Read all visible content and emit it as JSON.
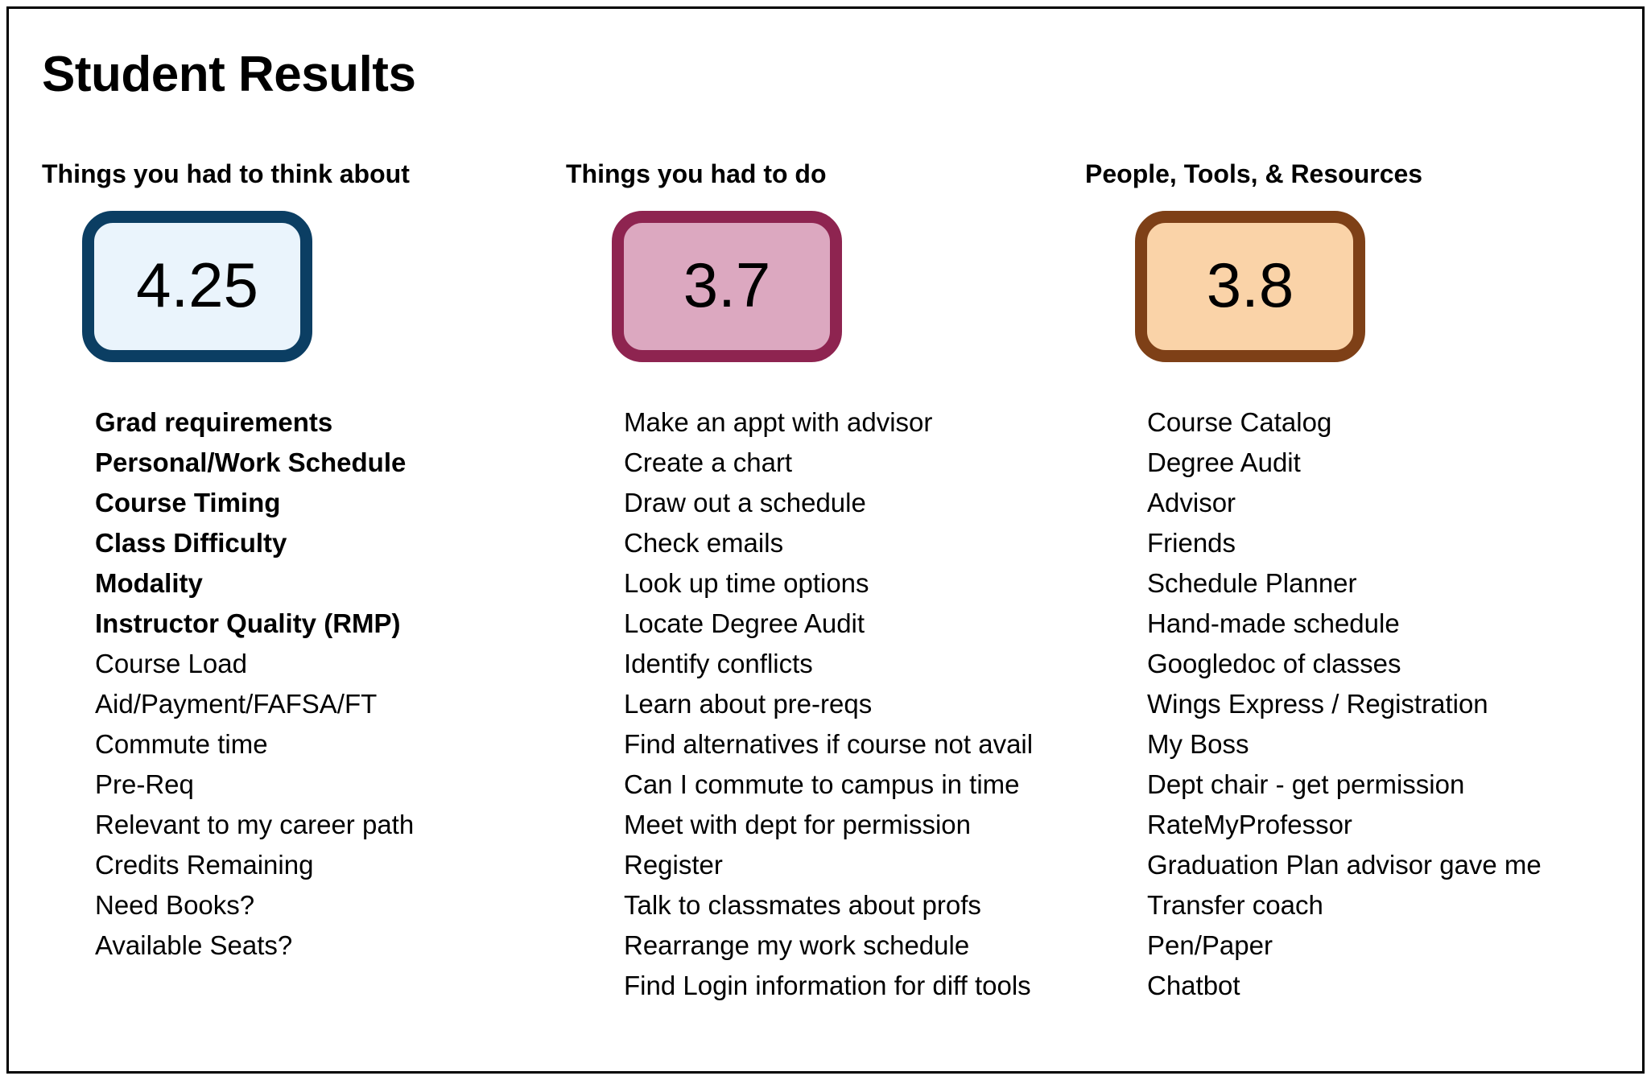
{
  "page": {
    "title": "Student Results",
    "border_color": "#000000",
    "background": "#ffffff"
  },
  "columns": [
    {
      "header": "Things you had to think about",
      "score": "4.25",
      "box_border_color": "#0B3E63",
      "box_fill_color": "#EAF4FC",
      "items": [
        {
          "label": "Grad requirements",
          "bold": true
        },
        {
          "label": "Personal/Work Schedule",
          "bold": true
        },
        {
          "label": "Course Timing",
          "bold": true
        },
        {
          "label": "Class Difficulty",
          "bold": true
        },
        {
          "label": "Modality",
          "bold": true
        },
        {
          "label": "Instructor Quality (RMP)",
          "bold": true
        },
        {
          "label": "Course Load",
          "bold": false
        },
        {
          "label": "Aid/Payment/FAFSA/FT",
          "bold": false
        },
        {
          "label": "Commute time",
          "bold": false
        },
        {
          "label": "Pre-Req",
          "bold": false
        },
        {
          "label": "Relevant to my career path",
          "bold": false
        },
        {
          "label": "Credits Remaining",
          "bold": false
        },
        {
          "label": "Need Books?",
          "bold": false
        },
        {
          "label": "Available Seats?",
          "bold": false
        }
      ]
    },
    {
      "header": "Things you had to do",
      "score": "3.7",
      "box_border_color": "#8E2450",
      "box_fill_color": "#DCA8C0",
      "items": [
        {
          "label": "Make an appt with advisor",
          "bold": false
        },
        {
          "label": "Create a chart",
          "bold": false
        },
        {
          "label": "Draw out a schedule",
          "bold": false
        },
        {
          "label": "Check emails",
          "bold": false
        },
        {
          "label": "Look up time options",
          "bold": false
        },
        {
          "label": "Locate Degree Audit",
          "bold": false
        },
        {
          "label": "Identify conflicts",
          "bold": false
        },
        {
          "label": "Learn about pre-reqs",
          "bold": false
        },
        {
          "label": "Find alternatives if course not avail",
          "bold": false
        },
        {
          "label": "Can I commute to campus in time",
          "bold": false
        },
        {
          "label": "Meet with dept for permission",
          "bold": false
        },
        {
          "label": "Register",
          "bold": false
        },
        {
          "label": "Talk to classmates about profs",
          "bold": false
        },
        {
          "label": "Rearrange my work schedule",
          "bold": false
        },
        {
          "label": "Find Login information for diff tools",
          "bold": false
        }
      ]
    },
    {
      "header": "People, Tools, & Resources",
      "score": "3.8",
      "box_border_color": "#7E4017",
      "box_fill_color": "#FAD3A8",
      "items": [
        {
          "label": "Course Catalog",
          "bold": false
        },
        {
          "label": "Degree Audit",
          "bold": false
        },
        {
          "label": "Advisor",
          "bold": false
        },
        {
          "label": "Friends",
          "bold": false
        },
        {
          "label": "Schedule Planner",
          "bold": false
        },
        {
          "label": "Hand-made schedule",
          "bold": false
        },
        {
          "label": "Googledoc of classes",
          "bold": false
        },
        {
          "label": "Wings Express / Registration",
          "bold": false
        },
        {
          "label": "My Boss",
          "bold": false
        },
        {
          "label": "Dept chair - get permission",
          "bold": false
        },
        {
          "label": "RateMyProfessor",
          "bold": false
        },
        {
          "label": "Graduation Plan advisor gave me",
          "bold": false
        },
        {
          "label": "Transfer coach",
          "bold": false
        },
        {
          "label": "Pen/Paper",
          "bold": false
        },
        {
          "label": "Chatbot",
          "bold": false
        }
      ]
    }
  ]
}
